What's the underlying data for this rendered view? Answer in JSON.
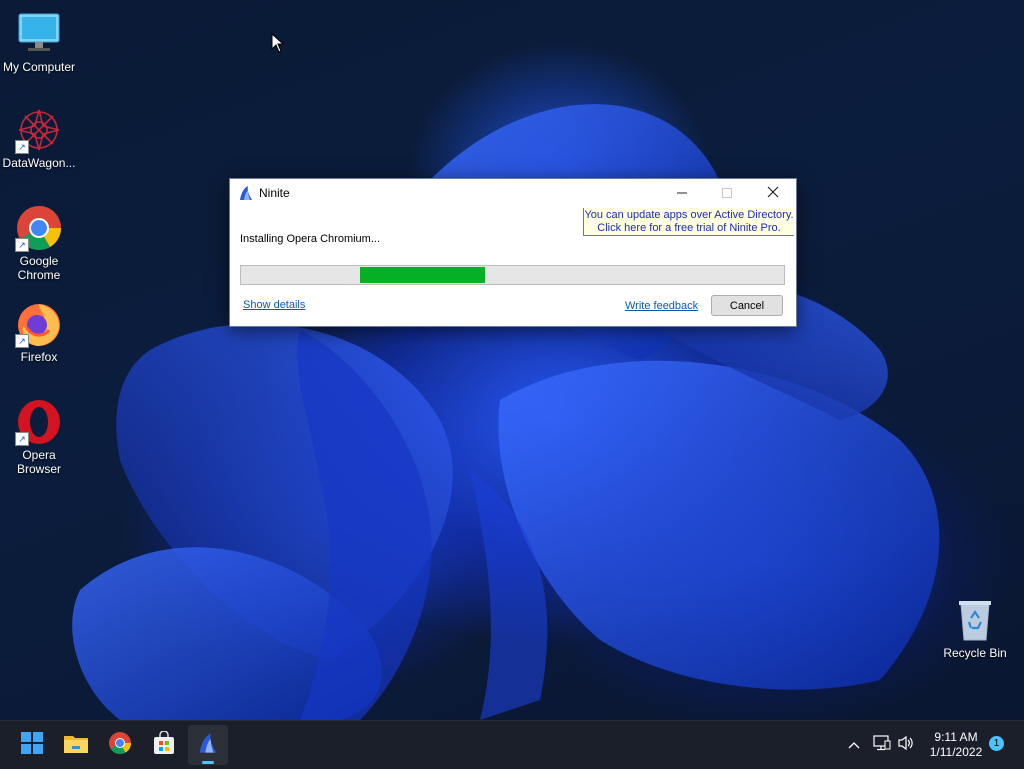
{
  "desktop": {
    "icons": [
      {
        "label": "My Computer",
        "icon": "computer-icon"
      },
      {
        "label": "DataWagon...",
        "icon": "datawagon-icon"
      },
      {
        "label": "Google Chrome",
        "icon": "chrome-icon"
      },
      {
        "label": "Firefox",
        "icon": "firefox-icon"
      },
      {
        "label": "Opera Browser",
        "icon": "opera-icon"
      },
      {
        "label": "Recycle Bin",
        "icon": "recycle-bin-icon"
      }
    ]
  },
  "dialog": {
    "title": "Ninite",
    "promo_line1": "You can update apps over Active Directory.",
    "promo_line2": "Click here for a free trial of Ninite Pro.",
    "status": "Installing Opera Chromium...",
    "progress_start": 0.22,
    "progress_fraction": 0.23,
    "show_details": "Show details",
    "write_feedback": "Write feedback",
    "cancel": "Cancel"
  },
  "taskbar": {
    "items": [
      "start-icon",
      "file-explorer-icon",
      "chrome-icon",
      "store-icon",
      "ninite-icon"
    ],
    "clock_time": "9:11 AM",
    "clock_date": "1/11/2022",
    "notification_count": "1"
  },
  "colors": {
    "progress_green": "#06b025",
    "link_blue": "#0a59b8",
    "promo_bg": "#ffffe1",
    "accent": "#4cc2ff"
  }
}
